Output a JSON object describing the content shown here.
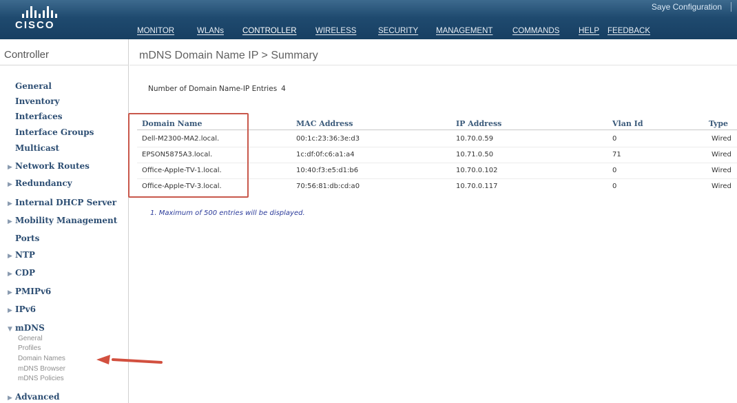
{
  "header": {
    "logo_text": "CISCO",
    "save_configuration": "Saye Configuration",
    "menu": [
      "MONITOR",
      "WLANs",
      "CONTROLLER",
      "WIRELESS",
      "SECURITY",
      "MANAGEMENT",
      "COMMANDS",
      "HELP",
      "FEEDBACK"
    ],
    "active_menu": "CONTROLLER"
  },
  "sidebar": {
    "title": "Controller",
    "items": [
      {
        "label": "General",
        "arrow": ""
      },
      {
        "label": "Inventory",
        "arrow": ""
      },
      {
        "label": "Interfaces",
        "arrow": ""
      },
      {
        "label": "Interface Groups",
        "arrow": ""
      },
      {
        "label": "Multicast",
        "arrow": ""
      },
      {
        "label": "Network Routes",
        "arrow": "▶"
      },
      {
        "label": "Redundancy",
        "arrow": "▶"
      },
      {
        "label": "Internal DHCP Server",
        "arrow": "▶"
      },
      {
        "label": "Mobility Management",
        "arrow": "▶"
      },
      {
        "label": "Ports",
        "arrow": ""
      },
      {
        "label": "NTP",
        "arrow": "▶"
      },
      {
        "label": "CDP",
        "arrow": "▶"
      },
      {
        "label": "PMIPv6",
        "arrow": "▶"
      },
      {
        "label": "IPv6",
        "arrow": "▶"
      },
      {
        "label": "mDNS",
        "arrow": "▼"
      }
    ],
    "mdns_subitems": [
      "General",
      "Profiles",
      "Domain Names",
      "mDNS Browser",
      "mDNS Policies"
    ],
    "advanced": {
      "label": "Advanced",
      "arrow": "▶"
    }
  },
  "main": {
    "title": "mDNS Domain Name IP > Summary",
    "count_label": "Number of Domain Name-IP Entries",
    "count_value": "4",
    "columns": [
      "Domain Name",
      "MAC Address",
      "IP Address",
      "Vlan Id",
      "Type"
    ],
    "rows": [
      [
        "Dell-M2300-MA2.local.",
        "00:1c:23:36:3e:d3",
        "10.70.0.59",
        "0",
        "Wired"
      ],
      [
        "EPSON5875A3.local.",
        "1c:df:0f:c6:a1:a4",
        "10.71.0.50",
        "71",
        "Wired"
      ],
      [
        "Office-Apple-TV-1.local.",
        "10:40:f3:e5:d1:b6",
        "10.70.0.102",
        "0",
        "Wired"
      ],
      [
        "Office-Apple-TV-3.local.",
        "70:56:81:db:cd:a0",
        "10.70.0.117",
        "0",
        "Wired"
      ]
    ],
    "footnote": "1. Maximum of 500 entries will be displayed."
  },
  "colors": {
    "header_bg": "#1f4a6f",
    "highlight_border": "#c8574a",
    "annotation_arrow": "#d2503f",
    "sidebar_link": "#2d4e73"
  }
}
